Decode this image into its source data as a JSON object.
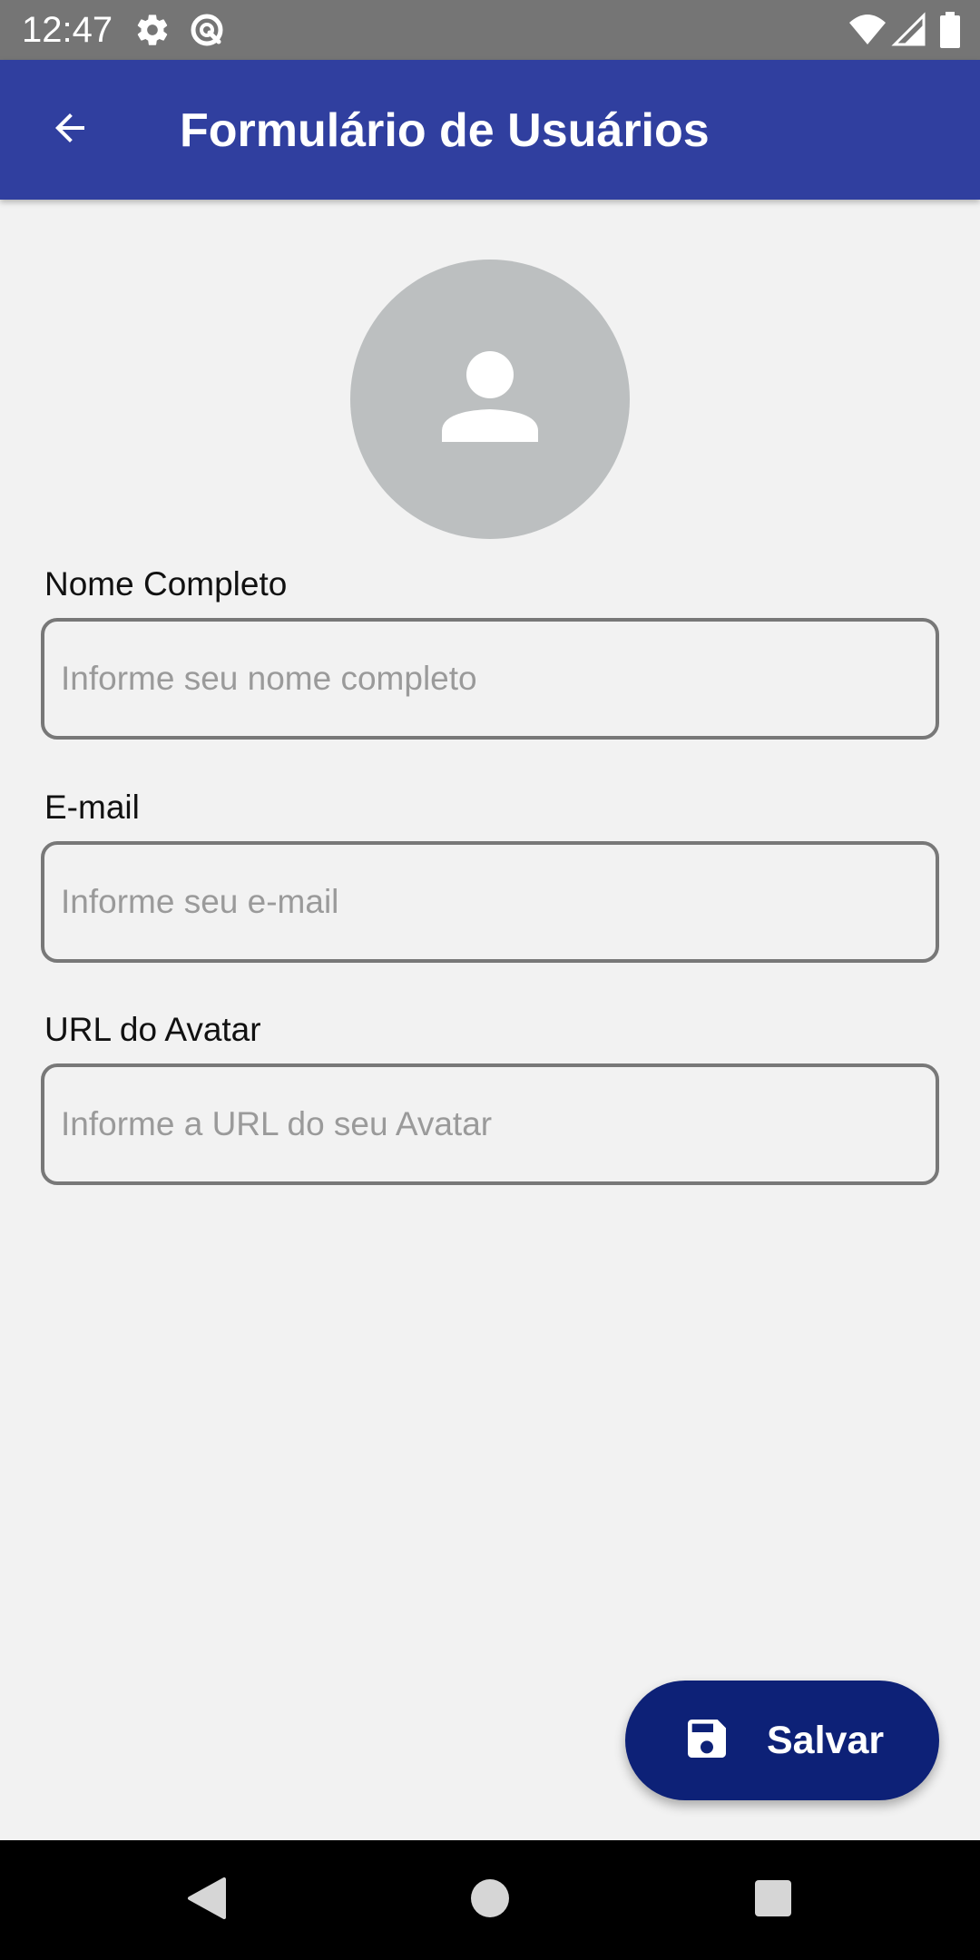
{
  "status_bar": {
    "time": "12:47",
    "icons": [
      "settings-icon",
      "data-saver-icon",
      "wifi-icon",
      "signal-icon",
      "battery-icon"
    ]
  },
  "app_bar": {
    "title": "Formulário de Usuários",
    "back_icon": "arrow-back-icon"
  },
  "avatar": {
    "icon": "person-icon"
  },
  "form": {
    "fields": [
      {
        "label": "Nome Completo",
        "placeholder": "Informe seu nome completo",
        "value": ""
      },
      {
        "label": "E-mail",
        "placeholder": "Informe seu e-mail",
        "value": ""
      },
      {
        "label": "URL do Avatar",
        "placeholder": "Informe a URL do seu Avatar",
        "value": ""
      }
    ]
  },
  "fab": {
    "label": "Salvar",
    "icon": "save-icon"
  },
  "nav_bar": {
    "buttons": [
      "back-triangle-icon",
      "home-circle-icon",
      "recents-square-icon"
    ]
  },
  "colors": {
    "app_bar": "#303f9f",
    "status_bar": "#757575",
    "fab": "#0d2177",
    "background": "#f2f2f2",
    "avatar": "#bcbfc0"
  }
}
